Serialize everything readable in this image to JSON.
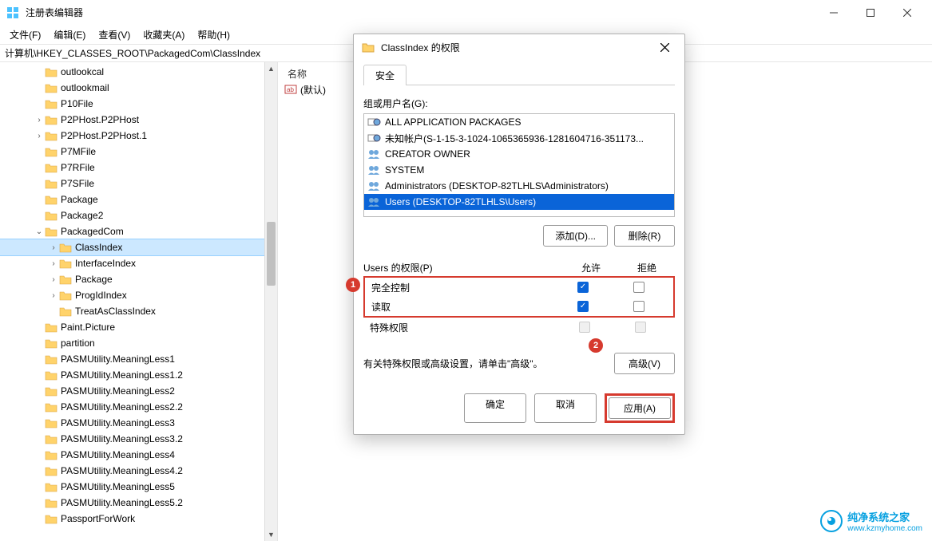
{
  "window": {
    "title": "注册表编辑器",
    "menus": [
      "文件(F)",
      "编辑(E)",
      "查看(V)",
      "收藏夹(A)",
      "帮助(H)"
    ],
    "address": "计算机\\HKEY_CLASSES_ROOT\\PackagedCom\\ClassIndex"
  },
  "tree": [
    {
      "depth": 2,
      "exp": "",
      "label": "outlookcal"
    },
    {
      "depth": 2,
      "exp": "",
      "label": "outlookmail"
    },
    {
      "depth": 2,
      "exp": "",
      "label": "P10File"
    },
    {
      "depth": 2,
      "exp": ">",
      "label": "P2PHost.P2PHost"
    },
    {
      "depth": 2,
      "exp": ">",
      "label": "P2PHost.P2PHost.1"
    },
    {
      "depth": 2,
      "exp": "",
      "label": "P7MFile"
    },
    {
      "depth": 2,
      "exp": "",
      "label": "P7RFile"
    },
    {
      "depth": 2,
      "exp": "",
      "label": "P7SFile"
    },
    {
      "depth": 2,
      "exp": "",
      "label": "Package"
    },
    {
      "depth": 2,
      "exp": "",
      "label": "Package2"
    },
    {
      "depth": 2,
      "exp": "v",
      "label": "PackagedCom"
    },
    {
      "depth": 3,
      "exp": ">",
      "label": "ClassIndex",
      "selected": true
    },
    {
      "depth": 3,
      "exp": ">",
      "label": "InterfaceIndex"
    },
    {
      "depth": 3,
      "exp": ">",
      "label": "Package"
    },
    {
      "depth": 3,
      "exp": ">",
      "label": "ProgIdIndex"
    },
    {
      "depth": 3,
      "exp": "",
      "label": "TreatAsClassIndex"
    },
    {
      "depth": 2,
      "exp": "",
      "label": "Paint.Picture"
    },
    {
      "depth": 2,
      "exp": "",
      "label": "partition"
    },
    {
      "depth": 2,
      "exp": "",
      "label": "PASMUtility.MeaningLess1"
    },
    {
      "depth": 2,
      "exp": "",
      "label": "PASMUtility.MeaningLess1.2"
    },
    {
      "depth": 2,
      "exp": "",
      "label": "PASMUtility.MeaningLess2"
    },
    {
      "depth": 2,
      "exp": "",
      "label": "PASMUtility.MeaningLess2.2"
    },
    {
      "depth": 2,
      "exp": "",
      "label": "PASMUtility.MeaningLess3"
    },
    {
      "depth": 2,
      "exp": "",
      "label": "PASMUtility.MeaningLess3.2"
    },
    {
      "depth": 2,
      "exp": "",
      "label": "PASMUtility.MeaningLess4"
    },
    {
      "depth": 2,
      "exp": "",
      "label": "PASMUtility.MeaningLess4.2"
    },
    {
      "depth": 2,
      "exp": "",
      "label": "PASMUtility.MeaningLess5"
    },
    {
      "depth": 2,
      "exp": "",
      "label": "PASMUtility.MeaningLess5.2"
    },
    {
      "depth": 2,
      "exp": "",
      "label": "PassportForWork"
    }
  ],
  "list": {
    "column_name": "名称",
    "default_value": "(默认)"
  },
  "dialog": {
    "title": "ClassIndex 的权限",
    "tab": "安全",
    "group_label": "组或用户名(G):",
    "users": [
      {
        "name": "ALL APPLICATION PACKAGES",
        "icon": "group"
      },
      {
        "name": "未知帐户(S-1-15-3-1024-1065365936-1281604716-351173...",
        "icon": "group"
      },
      {
        "name": "CREATOR OWNER",
        "icon": "users"
      },
      {
        "name": "SYSTEM",
        "icon": "users"
      },
      {
        "name": "Administrators (DESKTOP-82TLHLS\\Administrators)",
        "icon": "users"
      },
      {
        "name": "Users (DESKTOP-82TLHLS\\Users)",
        "icon": "users",
        "selected": true
      }
    ],
    "add_btn": "添加(D)...",
    "remove_btn": "删除(R)",
    "perm_title": "Users 的权限(P)",
    "col_allow": "允许",
    "col_deny": "拒绝",
    "perms": [
      {
        "name": "完全控制",
        "allow": true,
        "deny": false
      },
      {
        "name": "读取",
        "allow": true,
        "deny": false
      },
      {
        "name": "特殊权限",
        "allow": false,
        "deny": false,
        "disabled": true
      }
    ],
    "advanced_text": "有关特殊权限或高级设置，请单击\"高级\"。",
    "advanced_btn": "高级(V)",
    "ok_btn": "确定",
    "cancel_btn": "取消",
    "apply_btn": "应用(A)",
    "badge1": "1",
    "badge2": "2"
  },
  "watermark": {
    "text": "纯净系统之家",
    "url": "www.kzmyhome.com"
  }
}
